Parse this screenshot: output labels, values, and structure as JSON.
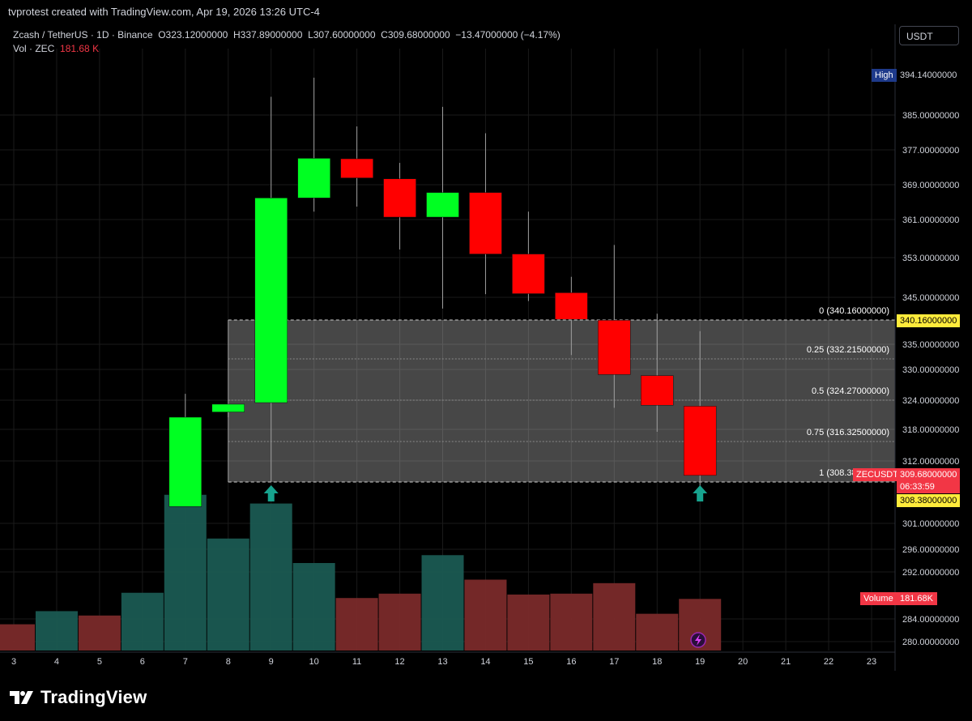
{
  "header": {
    "credit": "tvprotest created with TradingView.com, Apr 19, 2026 13:26 UTC-4"
  },
  "legend": {
    "symbol": "Zcash / TetherUS · 1D · Binance",
    "open_label": "O",
    "open": "323.12000000",
    "high_label": "H",
    "high": "337.89000000",
    "low_label": "L",
    "low": "307.60000000",
    "close_label": "C",
    "close": "309.68000000",
    "change": "−13.47000000 (−4.17%)",
    "vol_label": "Vol · ZEC",
    "vol_value": "181.68 K"
  },
  "currency_button": "USDT",
  "tags": {
    "high_label": "High",
    "high_value": "394.14000000",
    "fib0_value": "340.16000000",
    "symbol": "ZECUSDT",
    "last_price": "309.68000000",
    "countdown": "06:33:59",
    "fib1_value": "308.38000000",
    "volume_label": "Volume",
    "volume_value": "181.68K"
  },
  "colors": {
    "up": "#00ff22",
    "down": "#ff0000",
    "vol_up": "#1a5a52",
    "vol_down": "#7a2a2a",
    "zone": "#4a4a4a",
    "arrow": "#17a38e",
    "tag_yellow": "#ffeb3b",
    "tag_red": "#f23645",
    "tag_navy": "#1e3a8a"
  },
  "icons": {
    "arrow_marker": "up-arrow-icon",
    "bolt": "lightning-icon",
    "logo": "tradingview-logo-icon"
  },
  "footer": {
    "brand": "TradingView"
  },
  "chart_data": {
    "type": "candlestick",
    "title": "Zcash / TetherUS · 1D · Binance",
    "x_ticks": [
      "3",
      "4",
      "5",
      "6",
      "7",
      "8",
      "9",
      "10",
      "11",
      "12",
      "13",
      "14",
      "15",
      "16",
      "17",
      "18",
      "19",
      "20",
      "21",
      "22",
      "23"
    ],
    "y_ticks": [
      "385.00000000",
      "377.00000000",
      "369.00000000",
      "361.00000000",
      "353.00000000",
      "345.00000000",
      "335.00000000",
      "330.00000000",
      "324.00000000",
      "318.00000000",
      "312.00000000",
      "301.00000000",
      "296.00000000",
      "292.00000000",
      "284.00000000",
      "280.00000000"
    ],
    "candles": [
      {
        "day": "7",
        "open": 304,
        "high": 325.5,
        "low": 304,
        "close": 321
      },
      {
        "day": "8",
        "open": 322,
        "high": 323.5,
        "low": 321,
        "close": 323.5
      },
      {
        "day": "9",
        "open": 323.8,
        "high": 389,
        "low": 308.4,
        "close": 366.8
      },
      {
        "day": "10",
        "open": 366.8,
        "high": 393.2,
        "low": 363.8,
        "close": 375.5
      },
      {
        "day": "11",
        "open": 375.4,
        "high": 382.5,
        "low": 364.9,
        "close": 371.2
      },
      {
        "day": "12",
        "open": 371,
        "high": 374.5,
        "low": 355.5,
        "close": 362.6
      },
      {
        "day": "13",
        "open": 362.6,
        "high": 386.8,
        "low": 342.6,
        "close": 368
      },
      {
        "day": "14",
        "open": 368,
        "high": 381,
        "low": 345.7,
        "close": 354.5
      },
      {
        "day": "15",
        "open": 354.5,
        "high": 363.8,
        "low": 344.2,
        "close": 345.8
      },
      {
        "day": "16",
        "open": 346,
        "high": 349.5,
        "low": 333,
        "close": 340.3
      },
      {
        "day": "17",
        "open": 340.1,
        "high": 356.5,
        "low": 322.8,
        "close": 329.2
      },
      {
        "day": "18",
        "open": 329,
        "high": 341.5,
        "low": 318.2,
        "close": 323.3
      },
      {
        "day": "19",
        "open": 323.12,
        "high": 337.89,
        "low": 307.6,
        "close": 309.68
      }
    ],
    "volume": [
      {
        "day": "3",
        "value": 0.3,
        "dir": "down"
      },
      {
        "day": "4",
        "value": 0.45,
        "dir": "up"
      },
      {
        "day": "5",
        "value": 0.4,
        "dir": "down"
      },
      {
        "day": "6",
        "value": 0.66,
        "dir": "up"
      },
      {
        "day": "7",
        "value": 1.78,
        "dir": "up"
      },
      {
        "day": "8",
        "value": 1.28,
        "dir": "up"
      },
      {
        "day": "9",
        "value": 1.68,
        "dir": "up"
      },
      {
        "day": "10",
        "value": 1.0,
        "dir": "up"
      },
      {
        "day": "11",
        "value": 0.6,
        "dir": "down"
      },
      {
        "day": "12",
        "value": 0.65,
        "dir": "down"
      },
      {
        "day": "13",
        "value": 1.09,
        "dir": "up"
      },
      {
        "day": "14",
        "value": 0.81,
        "dir": "down"
      },
      {
        "day": "15",
        "value": 0.64,
        "dir": "down"
      },
      {
        "day": "16",
        "value": 0.65,
        "dir": "down"
      },
      {
        "day": "17",
        "value": 0.77,
        "dir": "down"
      },
      {
        "day": "18",
        "value": 0.42,
        "dir": "down"
      },
      {
        "day": "19",
        "value": 0.59,
        "dir": "down"
      }
    ],
    "fib_levels": [
      {
        "label": "0 (340.16000000)",
        "price": 340.16
      },
      {
        "label": "0.25 (332.21500000)",
        "price": 332.215
      },
      {
        "label": "0.5 (324.27000000)",
        "price": 324.27
      },
      {
        "label": "0.75 (316.32500000)",
        "price": 316.325
      },
      {
        "label": "1 (308.38000000)",
        "price": 308.38
      }
    ],
    "fib_start_day": "8",
    "markers": [
      {
        "day": "9",
        "shape": "up-arrow"
      },
      {
        "day": "19",
        "shape": "up-arrow"
      }
    ]
  }
}
